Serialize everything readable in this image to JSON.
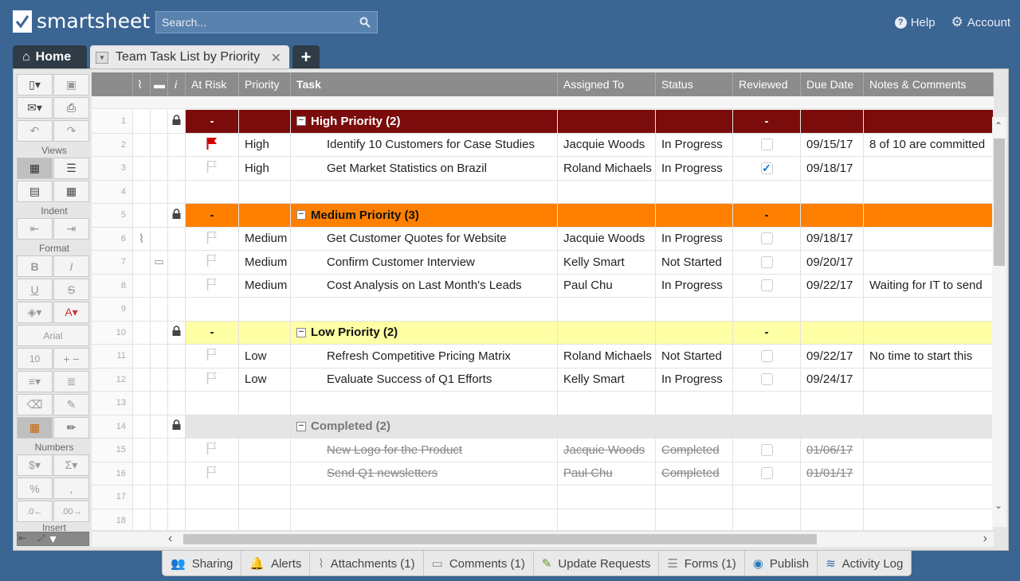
{
  "app": {
    "brand": "smartsheet"
  },
  "search": {
    "placeholder": "Search..."
  },
  "topnav": {
    "help": "Help",
    "account": "Account"
  },
  "tabs": {
    "home": "Home",
    "sheet": "Team Task List by Priority",
    "add": "+"
  },
  "toolbar": {
    "views_label": "Views",
    "indent_label": "Indent",
    "format_label": "Format",
    "font_name": "Arial",
    "font_size": "10",
    "numbers_label": "Numbers",
    "insert_label": "Insert"
  },
  "columns": {
    "at_risk": "At Risk",
    "priority": "Priority",
    "task": "Task",
    "assigned_to": "Assigned To",
    "status": "Status",
    "reviewed": "Reviewed",
    "due_date": "Due Date",
    "notes": "Notes & Comments"
  },
  "rows": [
    {
      "n": "1",
      "type": "group-high",
      "lock": true,
      "atrisk": "-",
      "task": "High Priority (2)",
      "reviewed": "-"
    },
    {
      "n": "2",
      "type": "task",
      "flag": "red",
      "priority": "High",
      "task": "Identify 10 Customers for Case Studies",
      "assigned": "Jacquie Woods",
      "status": "In Progress",
      "checked": false,
      "due": "09/15/17",
      "notes": "8 of 10 are committed"
    },
    {
      "n": "3",
      "type": "task",
      "flag": "empty",
      "priority": "High",
      "task": "Get Market Statistics on Brazil",
      "assigned": "Roland Michaels",
      "status": "In Progress",
      "checked": true,
      "due": "09/18/17",
      "notes": ""
    },
    {
      "n": "4",
      "type": "empty"
    },
    {
      "n": "5",
      "type": "group-med",
      "lock": true,
      "atrisk": "-",
      "task": "Medium Priority (3)",
      "reviewed": "-"
    },
    {
      "n": "6",
      "type": "task",
      "attach": true,
      "flag": "empty",
      "priority": "Medium",
      "task": "Get Customer Quotes for Website",
      "assigned": "Jacquie Woods",
      "status": "In Progress",
      "checked": false,
      "due": "09/18/17",
      "notes": ""
    },
    {
      "n": "7",
      "type": "task",
      "comment": true,
      "flag": "empty",
      "priority": "Medium",
      "task": "Confirm Customer Interview",
      "assigned": "Kelly Smart",
      "status": "Not Started",
      "checked": false,
      "due": "09/20/17",
      "notes": ""
    },
    {
      "n": "8",
      "type": "task",
      "flag": "empty",
      "priority": "Medium",
      "task": "Cost Analysis on Last Month's Leads",
      "assigned": "Paul Chu",
      "status": "In Progress",
      "checked": false,
      "due": "09/22/17",
      "notes": "Waiting for IT to send"
    },
    {
      "n": "9",
      "type": "empty"
    },
    {
      "n": "10",
      "type": "group-low",
      "lock": true,
      "atrisk": "-",
      "task": "Low Priority (2)",
      "reviewed": "-"
    },
    {
      "n": "11",
      "type": "task",
      "flag": "empty",
      "priority": "Low",
      "task": "Refresh Competitive Pricing Matrix",
      "assigned": "Roland Michaels",
      "status": "Not Started",
      "checked": false,
      "due": "09/22/17",
      "notes": "No time to start this"
    },
    {
      "n": "12",
      "type": "task",
      "flag": "empty",
      "priority": "Low",
      "task": "Evaluate Success of Q1 Efforts",
      "assigned": "Kelly Smart",
      "status": "In Progress",
      "checked": false,
      "due": "09/24/17",
      "notes": ""
    },
    {
      "n": "13",
      "type": "empty"
    },
    {
      "n": "14",
      "type": "group-comp",
      "lock": true,
      "atrisk": "",
      "task": "Completed (2)",
      "reviewed": ""
    },
    {
      "n": "15",
      "type": "done",
      "flag": "empty",
      "priority": "",
      "task": "New Logo for the Product",
      "assigned": "Jacquie Woods",
      "status": "Completed",
      "checked": false,
      "due": "01/06/17",
      "notes": ""
    },
    {
      "n": "16",
      "type": "done",
      "flag": "empty",
      "priority": "",
      "task": "Send Q1 newsletters",
      "assigned": "Paul Chu",
      "status": "Completed",
      "checked": false,
      "due": "01/01/17",
      "notes": ""
    },
    {
      "n": "17",
      "type": "empty"
    },
    {
      "n": "18",
      "type": "empty"
    }
  ],
  "bottombar": {
    "sharing": "Sharing",
    "alerts": "Alerts",
    "attachments": "Attachments (1)",
    "comments": "Comments (1)",
    "update_requests": "Update Requests",
    "forms": "Forms (1)",
    "publish": "Publish",
    "activity_log": "Activity Log"
  },
  "colors": {
    "bg": "#3b6593",
    "high": "#7b0c0c",
    "medium": "#ff8000",
    "low": "#ffffa5",
    "completed": "#e5e5e5"
  }
}
